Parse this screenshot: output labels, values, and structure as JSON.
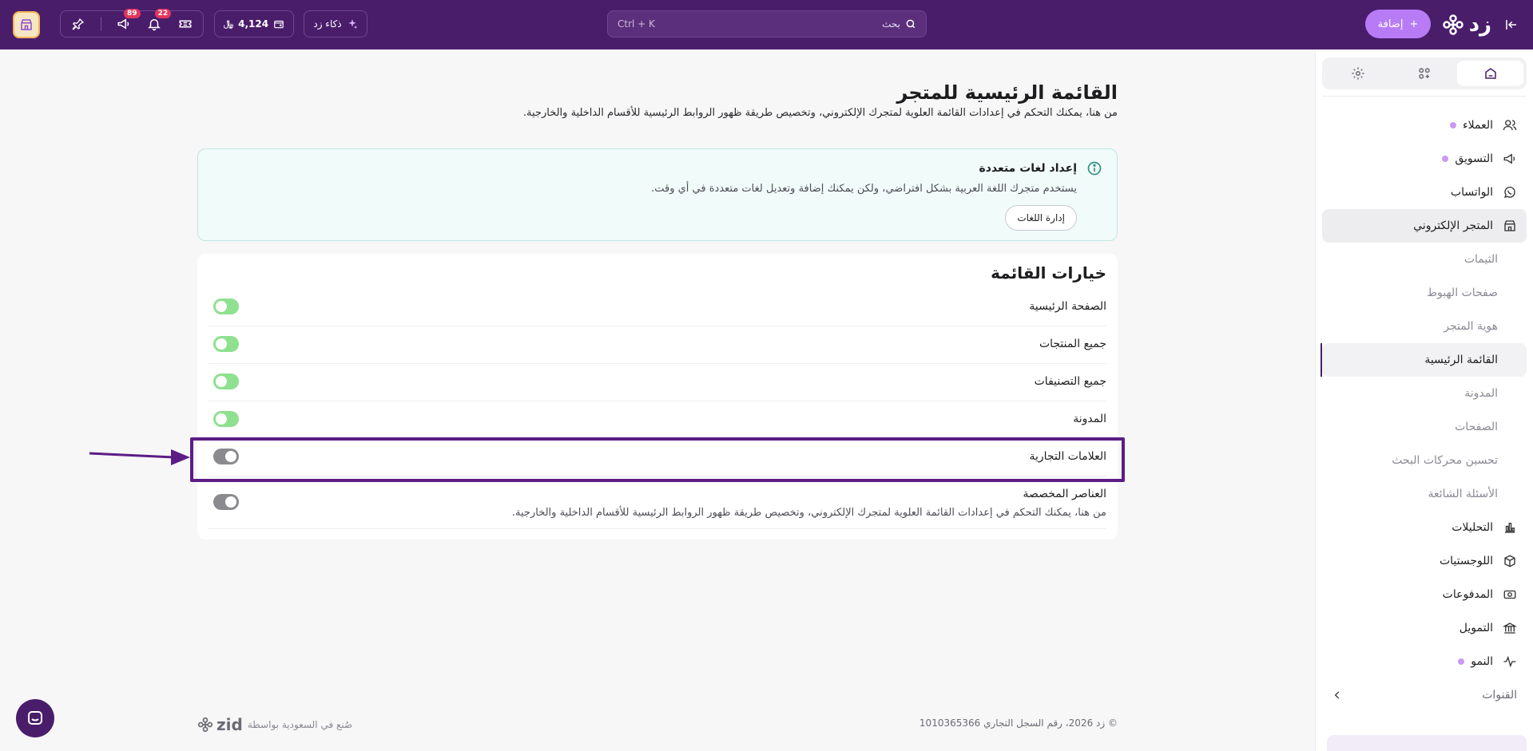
{
  "topbar": {
    "logo": "زد",
    "add_label": "إضافة",
    "search_label": "بحث",
    "search_shortcut": "Ctrl + K",
    "ai_label": "ذكاء زد",
    "balance": "4,124",
    "notifications_count": "22",
    "announcements_count": "89"
  },
  "sidebar": {
    "items": [
      {
        "label": "العملاء"
      },
      {
        "label": "التسويق"
      },
      {
        "label": "الواتساب"
      },
      {
        "label": "المتجر الإلكتروني"
      },
      {
        "label": "التحليلات"
      },
      {
        "label": "اللوجستيات"
      },
      {
        "label": "المدفوعات"
      },
      {
        "label": "التمويل"
      },
      {
        "label": "النمو"
      },
      {
        "label": "القنوات"
      }
    ],
    "subitems": [
      {
        "label": "الثيمات"
      },
      {
        "label": "صفحات الهبوط"
      },
      {
        "label": "هوية المتجر"
      },
      {
        "label": "القائمة الرئيسية"
      },
      {
        "label": "المدونة"
      },
      {
        "label": "الصفحات"
      },
      {
        "label": "تحسين محركات البحث"
      },
      {
        "label": "الأسئلة الشائعة"
      }
    ]
  },
  "page": {
    "title": "القائمة الرئيسية للمتجر",
    "subtitle": "من هنا، يمكنك التحكم في إعدادات القائمة العلوية لمتجرك الإلكتروني، وتخصيص طريقة ظهور الروابط الرئيسية للأقسام الداخلية والخارجية."
  },
  "info": {
    "title": "إعداد لغات متعددة",
    "text": "يستخدم متجرك اللغة العربية بشكل افتراضي، ولكن يمكنك إضافة وتعديل لغات متعددة في أي وقت.",
    "button": "إدارة اللغات"
  },
  "options": {
    "title": "خيارات القائمة",
    "rows": [
      {
        "label": "الصفحة الرئيسية",
        "enabled": true
      },
      {
        "label": "جميع المنتجات",
        "enabled": true
      },
      {
        "label": "جميع التصنيفات",
        "enabled": true
      },
      {
        "label": "المدونة",
        "enabled": true
      },
      {
        "label": "العلامات التجارية",
        "enabled": false
      },
      {
        "label": "العناصر المخصصة",
        "enabled": false,
        "description": "من هنا، يمكنك التحكم في إعدادات القائمة العلوية لمتجرك الإلكتروني، وتخصيص طريقة ظهور الروابط الرئيسية للأقسام الداخلية والخارجية."
      }
    ]
  },
  "footer": {
    "made_in": "صُنع في السعودية بواسطة",
    "brand": "zid",
    "copyright": "© زد 2026، رقم السجل التجاري 1010365366"
  },
  "colors": {
    "primary": "#4a1d6b",
    "accent": "#b77cf5",
    "toggle_on": "#8fe08f",
    "toggle_off": "#8a8a8f",
    "highlight": "#5c1c85"
  }
}
